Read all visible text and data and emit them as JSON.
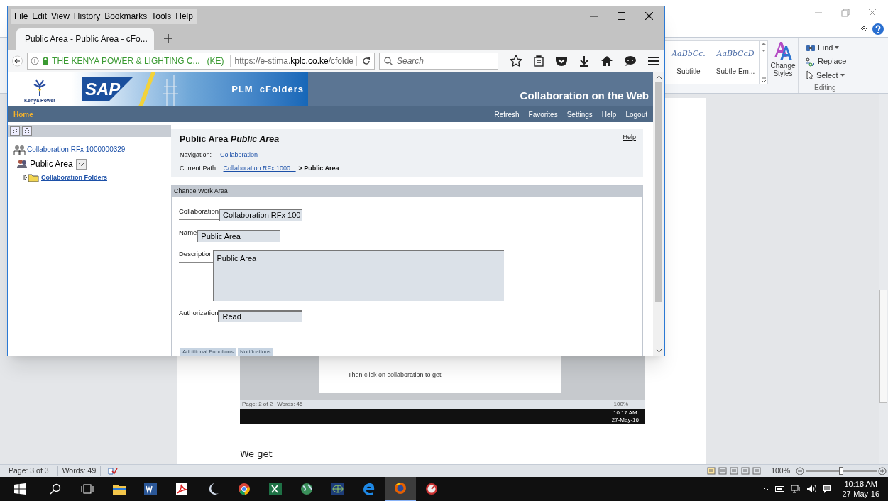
{
  "word": {
    "ribbon": {
      "styles": [
        {
          "sample": "AaBbCc.",
          "label": "Subtitle"
        },
        {
          "sample": "AaBbCcD",
          "label": "Subtle Em..."
        }
      ],
      "change_styles": "Change Styles",
      "editing": [
        "Find",
        "Replace",
        "Select"
      ],
      "editing_label": "Editing"
    },
    "document": {
      "embedded": {
        "caption": "Then click on collaboration to get",
        "status": [
          "Page: 2 of 2",
          "Words: 45"
        ],
        "zoom": "100%",
        "time": "10:17 AM",
        "date": "27-May-16"
      },
      "paragraph": "We get"
    },
    "status_bar": {
      "page": "Page: 3 of 3",
      "words": "Words: 49",
      "zoom": "100%",
      "zoom_slider": {
        "level": 0.5
      }
    }
  },
  "browser": {
    "menu": [
      "File",
      "Edit",
      "View",
      "History",
      "Bookmarks",
      "Tools",
      "Help"
    ],
    "tab": "Public Area - Public Area - cFo...",
    "identity": "THE KENYA POWER & LIGHTING C...",
    "country": "(KE)",
    "url": {
      "prefix": "https://e-stima.",
      "domain": "kplc.co.ke",
      "path": "/cfolde"
    },
    "search": {
      "placeholder": "Search"
    }
  },
  "page": {
    "brand": "Kenya Power",
    "sap_logo": "SAP",
    "product": "PLM  cFolders",
    "tagline": "Collaboration on the Web",
    "home": "Home",
    "nav_links": [
      "Refresh",
      "Favorites",
      "Settings",
      "Help",
      "Logout"
    ],
    "tree": [
      {
        "label": "Collaboration RFx 1000000329",
        "children": [
          {
            "label": "Public Area",
            "children": [
              {
                "label": "Collaboration Folders"
              }
            ]
          }
        ]
      }
    ],
    "heading": {
      "plain": "Public Area",
      "italic": "Public Area"
    },
    "help": "Help",
    "navigation": {
      "label": "Navigation:",
      "link": "Collaboration"
    },
    "path": {
      "label": "Current Path:",
      "link": "Collaboration RFx 1000...",
      "current": "> Public Area"
    },
    "panel_title": "Change Work Area",
    "fields": [
      {
        "label": "Collaboration",
        "value": "Collaboration RFx 100",
        "kind": "input"
      },
      {
        "label": "Name",
        "value": "Public Area",
        "kind": "input"
      },
      {
        "label": "Description",
        "value": "Public Area",
        "kind": "textarea"
      },
      {
        "label": "Authorization",
        "value": "Read",
        "kind": "input"
      }
    ],
    "bottom_tabs": [
      "Additional Functions",
      "Notifications"
    ]
  },
  "taskbar": {
    "apps": [
      {
        "kind": "explorer",
        "selected": false
      },
      {
        "kind": "word",
        "selected": false
      },
      {
        "kind": "pdf",
        "selected": false
      },
      {
        "kind": "moon",
        "selected": false
      },
      {
        "kind": "chrome",
        "selected": false
      },
      {
        "kind": "excel",
        "selected": false
      },
      {
        "kind": "globe",
        "selected": false
      },
      {
        "kind": "network",
        "selected": false
      },
      {
        "kind": "edge",
        "selected": false
      },
      {
        "kind": "firefox",
        "selected": true
      },
      {
        "kind": "gauge",
        "selected": false
      }
    ],
    "time": "10:18 AM",
    "date": "27-May-16"
  }
}
